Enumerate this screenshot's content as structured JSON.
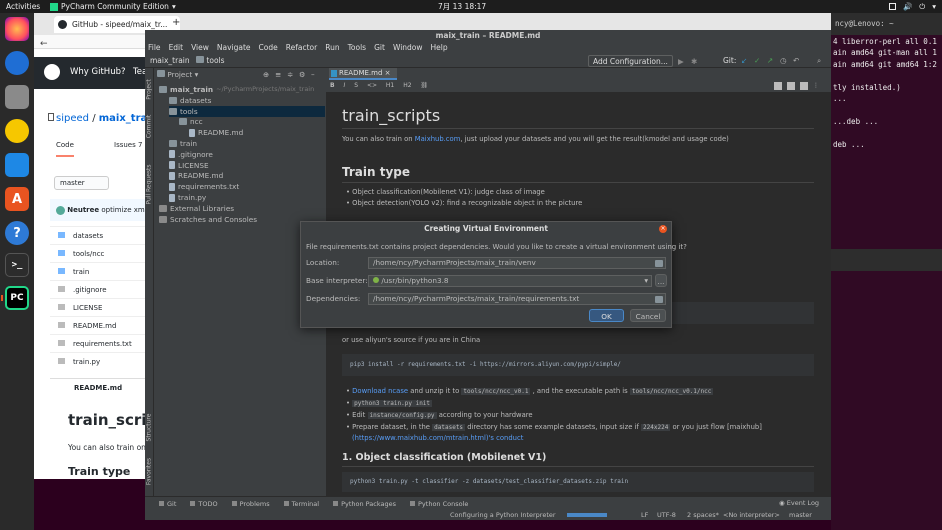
{
  "topbar": {
    "activities": "Activities",
    "app": "PyCharm Community Edition",
    "app_arrow": "▾",
    "clock": "7月 13  18:17",
    "tray": [
      "⏻",
      "🔊",
      "▾"
    ]
  },
  "firefox": {
    "tab_title": "GitHub - sipeed/maix_tr...",
    "new_tab": "+",
    "gh_nav": "Why GitHub?",
    "gh_nav_more": "Tea",
    "repo_owner": "sipeed",
    "repo_sep": "/",
    "repo_name": "maix_train",
    "tab_code": "Code",
    "tab_issues": "Issues",
    "tab_issues_count": "7",
    "branch": "master",
    "commit_user": "Neutree",
    "commit_msg": "optimize xml",
    "files": [
      "datasets",
      "tools/ncc",
      "train",
      ".gitignore",
      "LICENSE",
      "README.md",
      "requirements.txt",
      "train.py"
    ],
    "readme_header": "README.md",
    "readme_title": "train_scrip",
    "readme_text": "You can also train on",
    "readme_h2": "Train type"
  },
  "terminal": {
    "lines": [
      "ncy@Lenovo: ~",
      "4 liberror-perl all 0.1",
      "ain amd64 git-man all 1",
      "ain amd64 git amd64 1:2",
      "",
      "tly installed.)",
      "...",
      "",
      "...deb ...",
      "",
      "deb ..."
    ]
  },
  "pycharm": {
    "title": "maix_train – README.md",
    "menu": [
      "File",
      "Edit",
      "View",
      "Navigate",
      "Code",
      "Refactor",
      "Run",
      "Tools",
      "Git",
      "Window",
      "Help"
    ],
    "breadcrumb": [
      "maix_train",
      "tools"
    ],
    "add_config": "Add Configuration...",
    "git_label": "Git:",
    "project_label": "Project",
    "side_tabs": [
      "Project",
      "Commit",
      "Pull Requests",
      "Structure",
      "Favorites"
    ],
    "tree": [
      {
        "label": "maix_train",
        "extra": "~/PycharmProjects/maix_train",
        "kind": "folder",
        "depth": 0,
        "bold": true
      },
      {
        "label": "datasets",
        "kind": "folder",
        "depth": 1
      },
      {
        "label": "tools",
        "kind": "folder",
        "depth": 1,
        "selected": true
      },
      {
        "label": "ncc",
        "kind": "folder",
        "depth": 2
      },
      {
        "label": "README.md",
        "kind": "file",
        "depth": 3
      },
      {
        "label": "train",
        "kind": "folder",
        "depth": 1
      },
      {
        "label": ".gitignore",
        "kind": "file",
        "depth": 1
      },
      {
        "label": "LICENSE",
        "kind": "file",
        "depth": 1
      },
      {
        "label": "README.md",
        "kind": "file",
        "depth": 1
      },
      {
        "label": "requirements.txt",
        "kind": "file",
        "depth": 1
      },
      {
        "label": "train.py",
        "kind": "file",
        "depth": 1
      },
      {
        "label": "External Libraries",
        "kind": "lib",
        "depth": 0
      },
      {
        "label": "Scratches and Consoles",
        "kind": "lib",
        "depth": 0
      }
    ],
    "editor_tab": "README.md",
    "md": {
      "h1": "train_scripts",
      "p1a": "You can also train on ",
      "p1link": "Maixhub.com",
      "p1b": ", just upload your datasets and you will get the result(kmodel and usage code)",
      "h2": "Train type",
      "li1": "Object classification(Mobilenet V1): judge class of image",
      "li2": "Object detection(YOLO v2): find a recognizable object in the picture",
      "p2": "or use aliyun's source if you are in China",
      "code1": "pip3 install -r requirements.txt -i https://mirrors.aliyun.com/pypi/simple/",
      "b1a": "Download ",
      "b1link": "ncase",
      "b1b": " and unzip it to ",
      "b1code": "tools/ncc/ncc_v0.1",
      "b1c": " , and the executable path is ",
      "b1code2": "tools/ncc/ncc_v0.1/ncc",
      "b2": "python3 train.py init",
      "b3a": "Edit ",
      "b3code": "instance/config.py",
      "b3b": " according to your hardware",
      "b4a": "Prepare dataset, in the ",
      "b4code": "datasets",
      "b4b": " directory has some example datasets, input size if ",
      "b4code2": "224x224",
      "b4c": " or you just flow [maixhub]",
      "b4d": "(https://www.maixhub.com/mtrain.html)'s conduct",
      "h3": "1. Object classification (Mobilenet V1)",
      "code2": "python3 train.py -t classifier -z datasets/test_classifier_datasets.zip train"
    },
    "dialog": {
      "title": "Creating Virtual Environment",
      "message": "File requirements.txt contains project dependencies. Would you like to create a virtual environment using it?",
      "location_label": "Location:",
      "location_value": "/home/ncy/PycharmProjects/maix_train/venv",
      "base_label": "Base interpreter:",
      "base_value": "/usr/bin/python3.8",
      "deps_label": "Dependencies:",
      "deps_value": "/home/ncy/PycharmProjects/maix_train/requirements.txt",
      "ok": "OK",
      "cancel": "Cancel",
      "more": "..."
    },
    "bottom_tabs": [
      "Git",
      "TODO",
      "Problems",
      "Terminal",
      "Python Packages",
      "Python Console"
    ],
    "event_log": "Event Log",
    "status_msg": "Configuring a Python Interpreter",
    "status_right": [
      "LF",
      "UTF-8",
      "2 spaces*",
      "<No interpreter>",
      "master"
    ]
  },
  "colors": {
    "accent": "#4a88c7",
    "pycharm_bg": "#2b2b2b",
    "panel": "#3c3f41",
    "ubuntu_purple": "#300a24"
  }
}
